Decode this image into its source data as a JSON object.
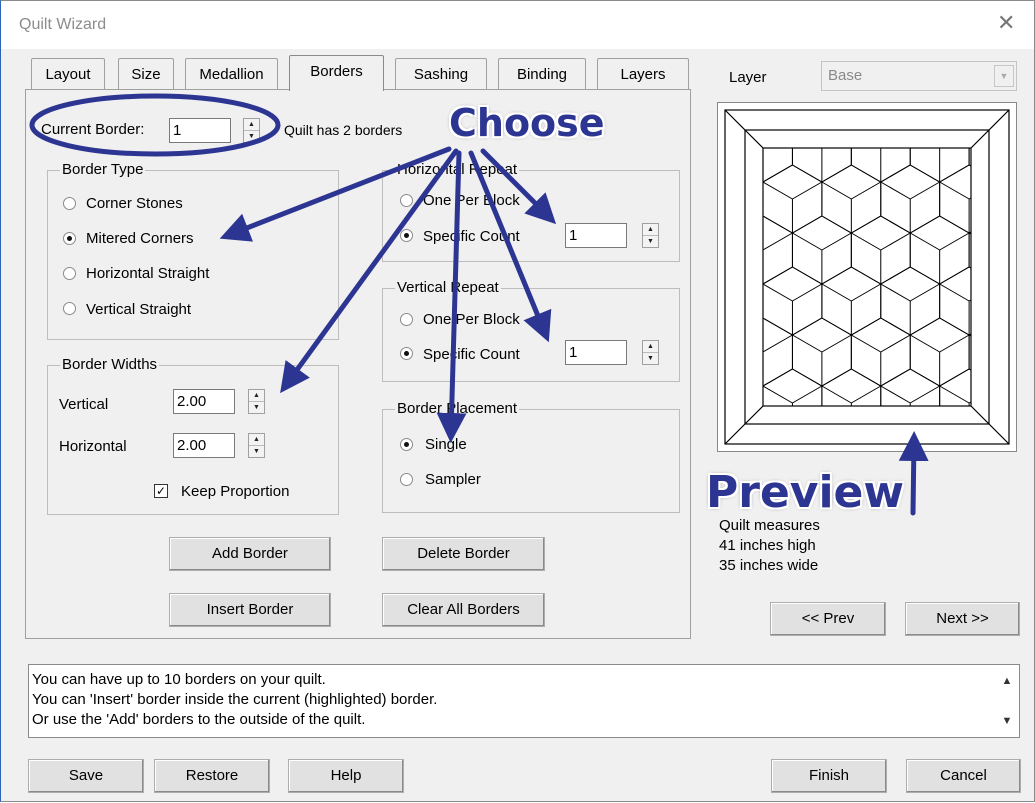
{
  "window": {
    "title": "Quilt Wizard"
  },
  "tabs": [
    {
      "label": "Layout"
    },
    {
      "label": "Size"
    },
    {
      "label": "Medallion"
    },
    {
      "label": "Borders"
    },
    {
      "label": "Sashing"
    },
    {
      "label": "Binding"
    },
    {
      "label": "Layers"
    }
  ],
  "current_border": {
    "label": "Current Border:",
    "value": "1",
    "status": "Quilt has 2 borders"
  },
  "border_type": {
    "title": "Border Type",
    "options": [
      {
        "label": "Corner Stones",
        "checked": false
      },
      {
        "label": "Mitered Corners",
        "checked": true
      },
      {
        "label": "Horizontal Straight",
        "checked": false
      },
      {
        "label": "Vertical Straight",
        "checked": false
      }
    ]
  },
  "border_widths": {
    "title": "Border Widths",
    "vertical_label": "Vertical",
    "vertical_value": "2.00",
    "horizontal_label": "Horizontal",
    "horizontal_value": "2.00",
    "keep_proportion_label": "Keep Proportion",
    "keep_proportion": true
  },
  "horizontal_repeat": {
    "title": "Horizontal Repeat",
    "option1": "One Per Block",
    "option2": "Specific Count",
    "count": "1",
    "selected": "Specific Count"
  },
  "vertical_repeat": {
    "title": "Vertical Repeat",
    "option1": "One Per Block",
    "option2": "Specific Count",
    "count": "1",
    "selected": "Specific Count"
  },
  "border_placement": {
    "title": "Border Placement",
    "option1": "Single",
    "option2": "Sampler",
    "selected": "Single"
  },
  "buttons": {
    "add_border": "Add Border",
    "delete_border": "Delete Border",
    "insert_border": "Insert Border",
    "clear_all_borders": "Clear All Borders",
    "prev": "<< Prev",
    "next": "Next >>",
    "save": "Save",
    "restore": "Restore",
    "help": "Help",
    "finish": "Finish",
    "cancel": "Cancel"
  },
  "layer": {
    "label": "Layer",
    "value": "Base"
  },
  "quilt_info": {
    "line1": "Quilt measures",
    "line2": "41 inches high",
    "line3": "35 inches wide"
  },
  "info_text": [
    "You can have up to 10 borders on your quilt.",
    "You can 'Insert' border inside the current (highlighted) border.",
    "Or use the 'Add' borders to the outside of the quilt."
  ],
  "annotations": {
    "choose": "Choose",
    "preview": "Preview",
    "color": "#2d3592"
  }
}
